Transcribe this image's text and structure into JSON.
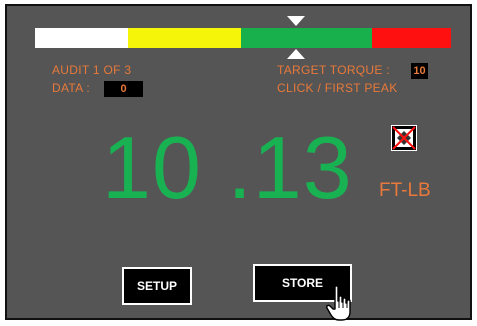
{
  "colors": {
    "panel_bg": "#555555",
    "accent_orange": "#e8793a",
    "reading_green": "#19b253",
    "gauge_white": "#ffffff",
    "gauge_yellow": "#f5f50a",
    "gauge_green": "#18b04d",
    "gauge_red": "#ff1010"
  },
  "gauge": {
    "segments": [
      "white",
      "yellow",
      "green",
      "red"
    ],
    "marker_level": 0.64
  },
  "audit": {
    "label": "AUDIT  1  OF  3"
  },
  "data_field": {
    "label": "DATA  :",
    "value": "0"
  },
  "target": {
    "label": "TARGET TORQUE :",
    "value": "10"
  },
  "mode": {
    "label": "CLICK / FIRST PEAK"
  },
  "reading": {
    "value": "10 .13",
    "unit": "FT-LB"
  },
  "icons": {
    "status_icon": "no-connection-icon",
    "cursor_icon": "hand-pointer-icon"
  },
  "buttons": {
    "setup": "SETUP",
    "store": "STORE"
  }
}
